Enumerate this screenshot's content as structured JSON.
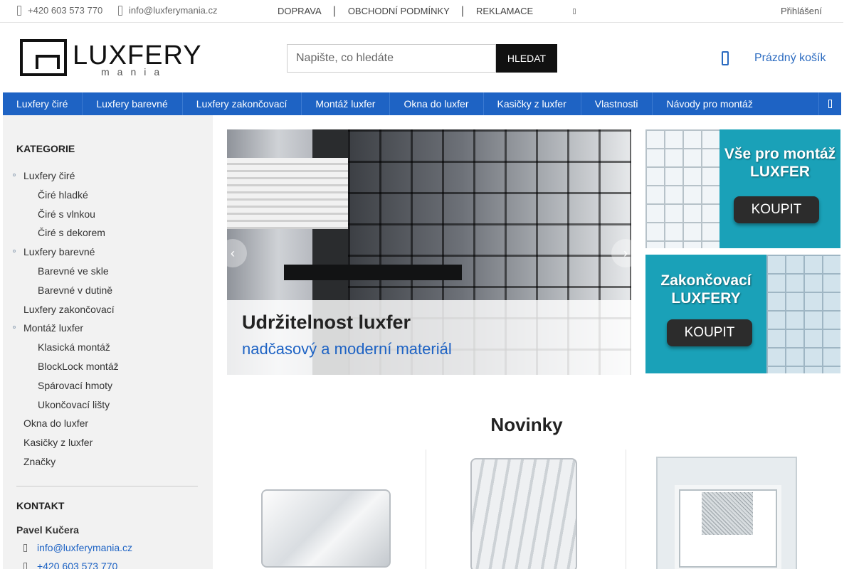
{
  "topbar": {
    "phone": "+420 603 573 770",
    "email": "info@luxferymania.cz",
    "nav": [
      "DOPRAVA",
      "OBCHODNÍ PODMÍNKY",
      "REKLAMACE"
    ],
    "login": "Přihlášení"
  },
  "logo": {
    "word": "LUXFERY",
    "sub": "mania"
  },
  "search": {
    "placeholder": "Napište, co hledáte",
    "button": "HLEDAT"
  },
  "cart": {
    "label": "Prázdný košík"
  },
  "main_nav": [
    "Luxfery čiré",
    "Luxfery barevné",
    "Luxfery zakončovací",
    "Montáž luxfer",
    "Okna do luxfer",
    "Kasičky z luxfer",
    "Vlastnosti",
    "Návody pro montáž"
  ],
  "sidebar": {
    "categories_title": "KATEGORIE",
    "categories": [
      {
        "label": "Luxfery čiré",
        "level": 0
      },
      {
        "label": "Čiré hladké",
        "level": 1
      },
      {
        "label": "Čiré s vlnkou",
        "level": 1
      },
      {
        "label": "Čiré s dekorem",
        "level": 1
      },
      {
        "label": "Luxfery barevné",
        "level": 0
      },
      {
        "label": "Barevné ve skle",
        "level": 1
      },
      {
        "label": "Barevné v dutině",
        "level": 1
      },
      {
        "label": "Luxfery zakončovací",
        "level": 0
      },
      {
        "label": "Montáž luxfer",
        "level": 0
      },
      {
        "label": "Klasická montáž",
        "level": 1
      },
      {
        "label": "BlockLock montáž",
        "level": 1
      },
      {
        "label": "Spárovací hmoty",
        "level": 1
      },
      {
        "label": "Ukončovací lišty",
        "level": 1
      },
      {
        "label": "Okna do luxfer",
        "level": 0
      },
      {
        "label": "Kasičky z luxfer",
        "level": 0
      },
      {
        "label": "Značky",
        "level": 0
      }
    ],
    "contact_title": "KONTAKT",
    "contact_name": "Pavel Kučera",
    "contact_email": "info@luxferymania.cz",
    "contact_phone": "+420 603 573 770"
  },
  "slider": {
    "title": "Udržitelnost luxfer",
    "subtitle": "nadčasový a moderní materiál"
  },
  "banners": [
    {
      "headline": "Vše pro montáž LUXFER",
      "button": "KOUPIT"
    },
    {
      "headline": "Zakončovací LUXFERY",
      "button": "KOUPIT"
    }
  ],
  "news": {
    "title": "Novinky"
  },
  "colors": {
    "accent": "#1e63c4",
    "banner_teal": "#1aa1b8",
    "dark": "#111111"
  }
}
